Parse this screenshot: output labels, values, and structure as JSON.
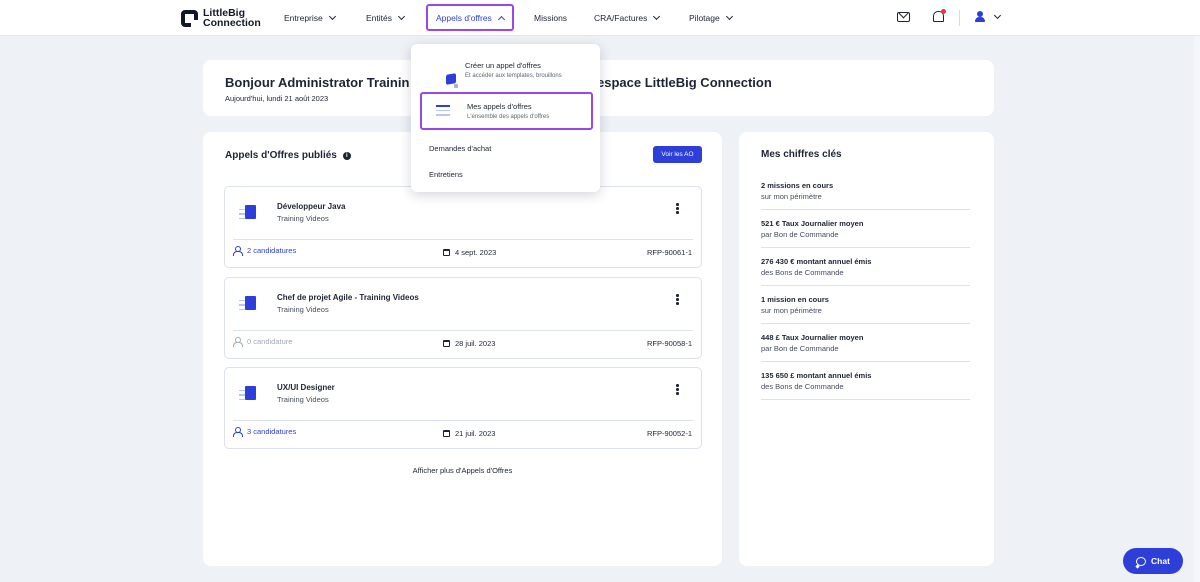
{
  "nav": {
    "logo": {
      "line1": "LittleBig",
      "line2": "Connection"
    },
    "items": [
      {
        "label": "Entreprise",
        "dropdown": true
      },
      {
        "label": "Entités",
        "dropdown": true
      },
      {
        "label": "Appels d'offres",
        "dropdown": true,
        "active": true
      },
      {
        "label": "Missions",
        "dropdown": false
      },
      {
        "label": "CRA/Factures",
        "dropdown": true
      },
      {
        "label": "Pilotage",
        "dropdown": true
      }
    ],
    "icons": [
      "mail-icon",
      "bell-icon",
      "user-icon"
    ]
  },
  "greeting": {
    "title_start": "Bonjour Administrator Trainin",
    "title_end": "espace LittleBig Connection",
    "date": "Aujourd'hui, lundi 21 août 2023"
  },
  "dropdown": {
    "items": [
      {
        "label": "Créer un appel d'offres",
        "desc": "Et accéder aux templates, brouillons"
      },
      {
        "label": "Mes appels d'offres",
        "desc": "L'ensemble des appels d'offres",
        "selected": true
      }
    ],
    "plain_items": [
      "Demandes d'achat",
      "Entretiens"
    ]
  },
  "ao": {
    "title": "Appels d'Offres publiés",
    "info_glyph": "i",
    "voir_label": "Voir les AO",
    "more_label": "Afficher plus d'Appels d'Offres",
    "items": [
      {
        "name": "Développeur Java",
        "sub": "Training Videos",
        "candidatures": "2 candidatures",
        "date": "4 sept. 2023",
        "ref": "RFP-90061-1"
      },
      {
        "name": "Chef de projet Agile - Training Videos",
        "sub": "Training Videos",
        "candidatures": "0 candidature",
        "date": "28 juil. 2023",
        "ref": "RFP-90058-1"
      },
      {
        "name": "UX/UI Designer",
        "sub": "Training Videos",
        "candidatures": "3 candidatures",
        "date": "21 juil. 2023",
        "ref": "RFP-90052-1"
      }
    ]
  },
  "kpis": {
    "title": "Mes chiffres clés",
    "items": [
      {
        "value": "2 missions en cours",
        "desc": "sur mon périmètre"
      },
      {
        "value": "521 € Taux Journalier moyen",
        "desc": "par Bon de Commande"
      },
      {
        "value": "276 430 € montant annuel émis",
        "desc": "des Bons de Commande"
      },
      {
        "value": "1 mission en cours",
        "desc": "sur mon périmètre"
      },
      {
        "value": "448 £ Taux Journalier moyen",
        "desc": "par Bon de Commande"
      },
      {
        "value": "135 650 £ montant annuel émis",
        "desc": "des Bons de Commande"
      }
    ]
  },
  "chat": {
    "label": "Chat"
  },
  "colors": {
    "accent": "#2d3fd8",
    "highlight": "#9b45f0",
    "background": "#eef1f6"
  }
}
